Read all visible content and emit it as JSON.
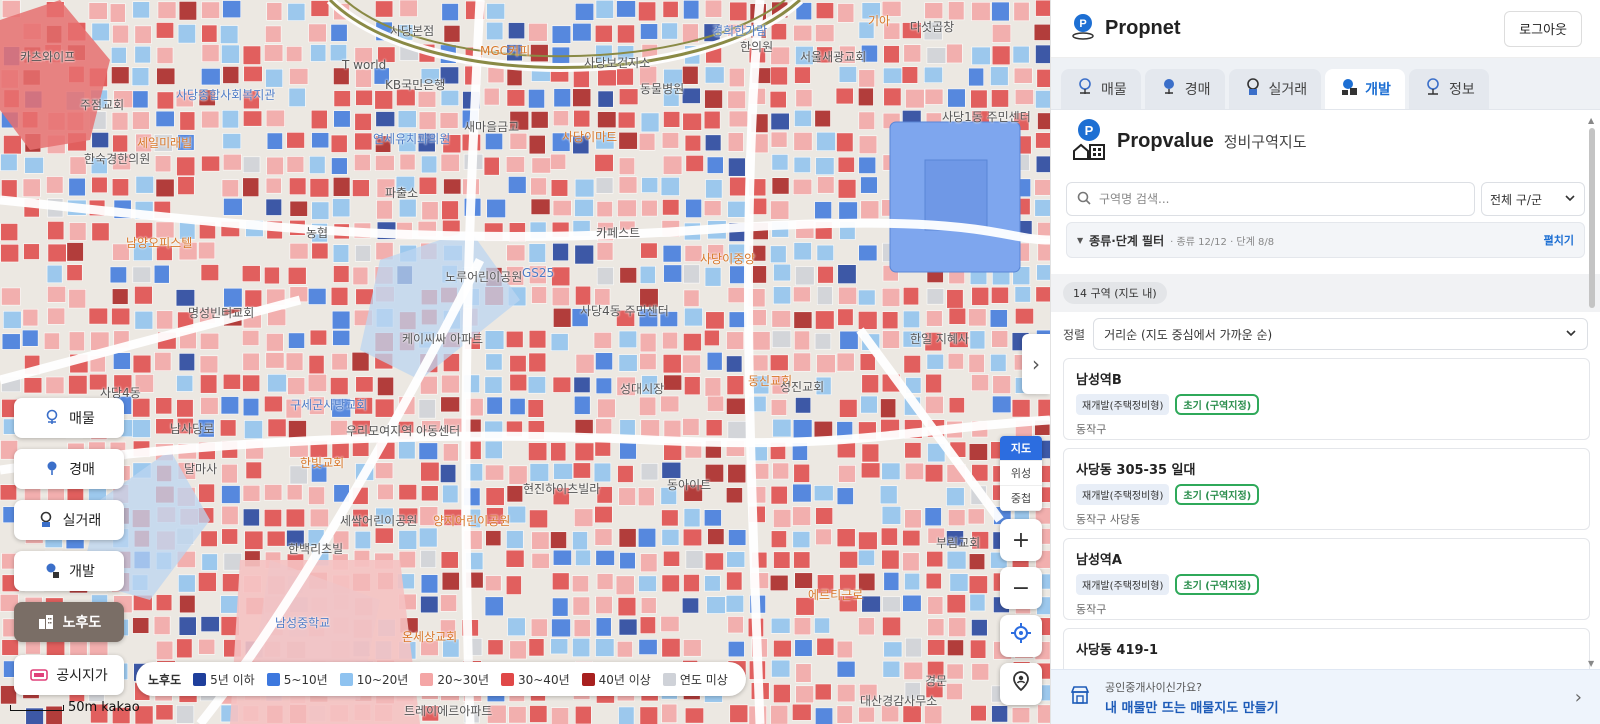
{
  "app": {
    "name": "Propnet",
    "logout_label": "로그아웃"
  },
  "tabs": [
    {
      "label": "매물",
      "icon": "listing-pin-icon"
    },
    {
      "label": "경매",
      "icon": "auction-pin-icon"
    },
    {
      "label": "실거래",
      "icon": "transaction-pin-icon"
    },
    {
      "label": "개발",
      "icon": "development-pin-icon",
      "active": true
    },
    {
      "label": "정보",
      "icon": "info-pin-icon"
    }
  ],
  "propvalue": {
    "name": "Propvalue",
    "subtitle": "정비구역지도",
    "search_placeholder": "구역명 검색...",
    "district_select": "전체 구/군",
    "filter": {
      "title": "종류·단계 필터",
      "summary": "· 종류 12/12 · 단계 8/8",
      "expand_label": "펼치기"
    },
    "count_badge": "14  구역 (지도 내)",
    "sort": {
      "label": "정렬",
      "value": "거리순 (지도 중심에서 가까운 순)"
    },
    "zones": [
      {
        "name": "남성역B",
        "type": "재개발(주택정비형)",
        "stage": "초기 (구역지정)",
        "district": "동작구"
      },
      {
        "name": "사당동 305-35 일대",
        "type": "재개발(주택정비형)",
        "stage": "초기 (구역지정)",
        "district": "동작구 사당동"
      },
      {
        "name": "남성역A",
        "type": "재개발(주택정비형)",
        "stage": "초기 (구역지정)",
        "district": "동작구"
      },
      {
        "name": "사당동 419-1",
        "type": "",
        "stage": "",
        "district": ""
      }
    ]
  },
  "promo": {
    "question": "공인중개사이신가요?",
    "cta": "내 매물만 뜨는 매물지도 만들기"
  },
  "map_controls": {
    "left_buttons": [
      {
        "label": "매물",
        "icon": "listing-pin-icon"
      },
      {
        "label": "경매",
        "icon": "auction-pin-icon"
      },
      {
        "label": "실거래",
        "icon": "transaction-pin-icon"
      },
      {
        "label": "개발",
        "icon": "development-pin-icon"
      },
      {
        "label": "노후도",
        "icon": "building-age-icon",
        "active": true
      },
      {
        "label": "공시지가",
        "icon": "land-price-icon"
      }
    ],
    "map_types": [
      "지도",
      "위성",
      "중첩"
    ],
    "map_type_active": "지도",
    "scale_label": "50m",
    "provider": "kakao"
  },
  "legend": {
    "title": "노후도",
    "items": [
      {
        "label": "5년 이하",
        "color": "#1f3f9c"
      },
      {
        "label": "5~10년",
        "color": "#3d78de"
      },
      {
        "label": "10~20년",
        "color": "#8fc3f0"
      },
      {
        "label": "20~30년",
        "color": "#f4a6a6"
      },
      {
        "label": "30~40년",
        "color": "#e04848"
      },
      {
        "label": "40년 이상",
        "color": "#a8201f"
      },
      {
        "label": "연도 미상",
        "color": "#cfd2d8"
      }
    ]
  },
  "map_labels": [
    "사당본점",
    "MGC커피",
    "사당보건지소",
    "경희한가람",
    "한의원",
    "서울새광교회",
    "기아",
    "다섯곱창",
    "카츠와이프",
    "주점교회",
    "사당종합사회복지관",
    "세일미래빌",
    "T world",
    "KB국민은행",
    "동물병원",
    "새마을금고",
    "사당이마트",
    "연세유치과의원",
    "파출소",
    "사당1동 주민센터",
    "한숙경한의원",
    "남양오피스텔",
    "농협",
    "노루어린이공원",
    "GS25",
    "카페스트",
    "사당이중앙",
    "사당4동 주민센터",
    "성대시장",
    "케이씨싸 아파트",
    "명성빈터교회",
    "동신교회",
    "사당4동",
    "우리모여지역 아동센터",
    "성진교회",
    "남사당로",
    "한빛교회",
    "한일 지혜사",
    "구세군사당교회",
    "달마사",
    "세싹어린이공원",
    "양지어린이공원",
    "한백리츠빌",
    "동아이트",
    "현진하이츠빌라",
    "남성중학교",
    "온세상교회",
    "트레이에르아파트",
    "경문",
    "대산경감사무소",
    "부림교회",
    "에르티근로"
  ]
}
